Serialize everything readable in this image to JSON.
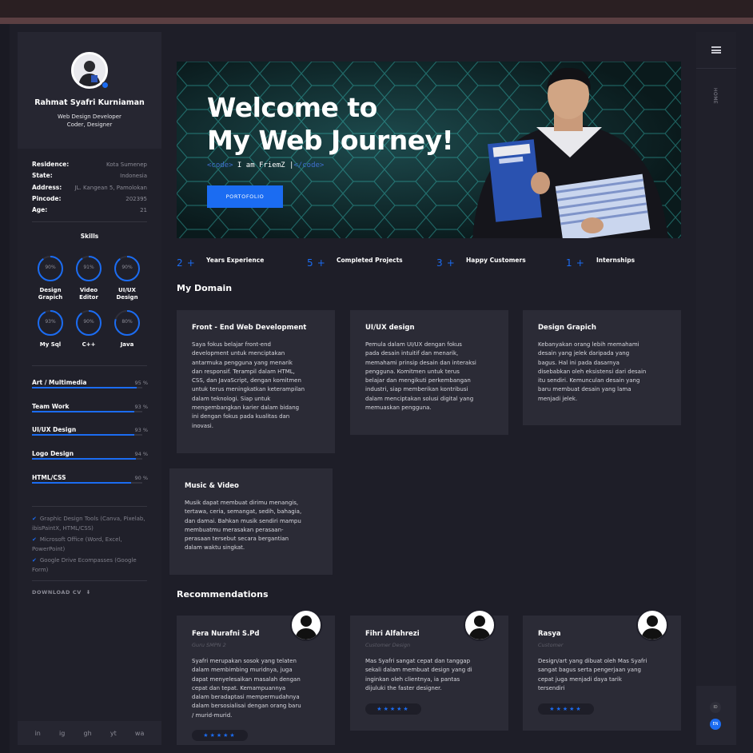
{
  "colors": {
    "accent": "#1b6cf2",
    "panel": "#20202a",
    "card": "#2b2b36",
    "background": "#1a1a23"
  },
  "profile": {
    "name": "Rahmat Syafri Kurniaman",
    "role_line1": "Web Design Developer",
    "role_line2": "Coder, Designer"
  },
  "info": [
    {
      "key": "Residence:",
      "value": "Kota Sumenep"
    },
    {
      "key": "State:",
      "value": "Indonesia"
    },
    {
      "key": "Address:",
      "value": "JL. Kangean 5, Pamolokan"
    },
    {
      "key": "Pincode:",
      "value": "202395"
    },
    {
      "key": "Age:",
      "value": "21"
    }
  ],
  "skills_title": "Skills",
  "ring_skills": [
    {
      "value": "90%",
      "label1": "Design",
      "label2": "Grapich",
      "percent": 90
    },
    {
      "value": "91%",
      "label1": "Video",
      "label2": "Editor",
      "percent": 91
    },
    {
      "value": "90%",
      "label1": "UI/UX",
      "label2": "Design",
      "percent": 90
    },
    {
      "value": "93%",
      "label1": "My Sql",
      "label2": "",
      "percent": 93
    },
    {
      "value": "90%",
      "label1": "C++",
      "label2": "",
      "percent": 90
    },
    {
      "value": "80%",
      "label1": "Java",
      "label2": "",
      "percent": 80
    }
  ],
  "bar_skills": [
    {
      "label": "Art / Multimedia",
      "value": "95 %",
      "percent": 95
    },
    {
      "label": "Team Work",
      "value": "93 %",
      "percent": 93
    },
    {
      "label": "UI/UX Design",
      "value": "93 %",
      "percent": 93
    },
    {
      "label": "Logo Design",
      "value": "94 %",
      "percent": 94
    },
    {
      "label": "HTML/CSS",
      "value": "90 %",
      "percent": 90
    }
  ],
  "tools": [
    "Graphic Design Tools (Canva, Pixelab, ibisPaintX, HTML/CSS)",
    "Microsoft Office (Word, Excel, PowerPoint)",
    "Google Drive Ecompasses (Google Form)"
  ],
  "download_cv": "DOWNLOAD CV",
  "socials": [
    "in",
    "ig",
    "gh",
    "yt",
    "wa"
  ],
  "rail": {
    "home": "HOME",
    "lang1": "ID",
    "lang2": "EN"
  },
  "hero": {
    "title_line1": "Welcome to",
    "title_line2": "My Web Journey!",
    "code_open": "<code>",
    "code_text": " I am FriemZ ",
    "code_cursor": "|",
    "code_close": "</code>",
    "button": "PORTOFOLIO"
  },
  "stats": [
    {
      "number": "2",
      "plus": "+",
      "label": "Years Experience"
    },
    {
      "number": "5",
      "plus": "+",
      "label": "Completed Projects"
    },
    {
      "number": "3",
      "plus": "+",
      "label": "Happy Customers"
    },
    {
      "number": "1",
      "plus": "+",
      "label": "Internships"
    }
  ],
  "domain_title": "My Domain",
  "domains": [
    {
      "title": "Front - End Web Development",
      "lines": [
        "Saya fokus belajar front-end",
        "development untuk menciptakan",
        "antarmuka pengguna yang menarik",
        "dan responsif. Terampil dalam HTML,",
        "CSS, dan JavaScript, dengan komitmen",
        "untuk terus meningkatkan keterampilan",
        "dalam teknologi. Siap untuk",
        "mengembangkan karier dalam bidang",
        "ini dengan fokus pada kualitas dan",
        "inovasi."
      ]
    },
    {
      "title": "UI/UX design",
      "lines": [
        "Pemula dalam UI/UX dengan fokus",
        "pada desain intuitif dan menarik,",
        "memahami prinsip desain dan interaksi",
        "pengguna. Komitmen untuk terus",
        "belajar dan mengikuti perkembangan",
        "industri, siap memberikan kontribusi",
        "dalam menciptakan solusi digital yang",
        "memuaskan pengguna."
      ]
    },
    {
      "title": "Design Grapich",
      "lines": [
        "Kebanyakan orang lebih memahami",
        "desain yang jelek daripada yang",
        "bagus. Hal ini pada dasarnya",
        "disebabkan oleh eksistensi dari desain",
        "itu sendiri. Kemunculan desain yang",
        "baru membuat desain yang lama",
        "menjadi jelek."
      ]
    },
    {
      "title": "Music & Video",
      "lines": [
        "Musik dapat membuat dirimu menangis,",
        "tertawa, ceria, semangat, sedih, bahagia,",
        "dan damai. Bahkan musik sendiri mampu",
        "membuatmu merasakan perasaan-",
        "perasaan tersebut secara bergantian",
        "dalam waktu singkat."
      ]
    }
  ],
  "rec_title": "Recommendations",
  "recommendations": [
    {
      "name": "Fera Nurafni S.Pd",
      "role": "Guru SMPN 2",
      "lines": [
        "Syafri merupakan sosok yang telaten",
        "dalam membimbing muridnya, juga",
        "dapat menyelesaikan masalah dengan",
        "cepat dan tepat. Kemampuannya",
        "dalam beradaptasi mempermudahnya",
        "dalam bersosialisai dengan orang baru",
        "/ murid-murid."
      ],
      "stars": "★★★★★",
      "rating": 5
    },
    {
      "name": "Fihri Alfahrezi",
      "role": "Customer Design",
      "lines": [
        "Mas Syafri sangat cepat dan tanggap",
        "sekali dalam membuat design yang di",
        "inginkan oleh clientnya, ia pantas",
        "dijuluki the faster designer."
      ],
      "stars": "★★★★★",
      "rating": 5
    },
    {
      "name": "Rasya",
      "role": "Customer",
      "lines": [
        "Design/art yang dibuat oleh Mas Syafri",
        "sangat bagus serta pengerjaan yang",
        "cepat juga menjadi daya tarik",
        "tersendiri"
      ],
      "stars": "★★★★★",
      "rating": 5
    }
  ]
}
